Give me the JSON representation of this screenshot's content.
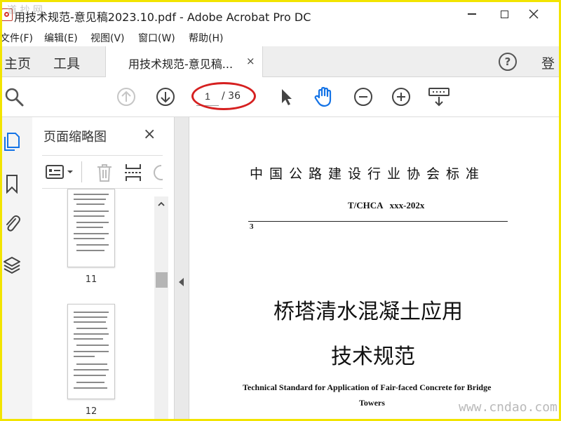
{
  "window": {
    "title": "用技术规范-意见稿2023.10.pdf - Adobe Acrobat Pro DC",
    "watermark_top": "道 抄 网"
  },
  "menu": {
    "items": [
      "文件(F)",
      "编辑(E)",
      "视图(V)",
      "窗口(W)",
      "帮助(H)"
    ]
  },
  "tabs": {
    "home": "主页",
    "tools": "工具",
    "document": "用技术规范-意见稿...",
    "close": "×",
    "help": "?",
    "signin": "登"
  },
  "toolbar": {
    "page_current": "1",
    "page_total": "/ 36"
  },
  "thumbnail_panel": {
    "title": "页面缩略图",
    "close": "×",
    "pages": [
      {
        "number": "11"
      },
      {
        "number": "12"
      }
    ]
  },
  "document": {
    "org": "中国公路建设行业协会标准",
    "code": "T/CHCA   xxx-202x",
    "number": "3",
    "title_line1": "桥塔清水混凝土应用",
    "title_line2": "技术规范",
    "english_line1": "Technical Standard for Application of Fair-faced Concrete for Bridge",
    "english_line2": "Towers"
  },
  "watermark": "www.cndao.com",
  "colors": {
    "accent_blue": "#1473e6",
    "annotation_red": "#d62020",
    "frame_yellow": "#f2e400"
  }
}
